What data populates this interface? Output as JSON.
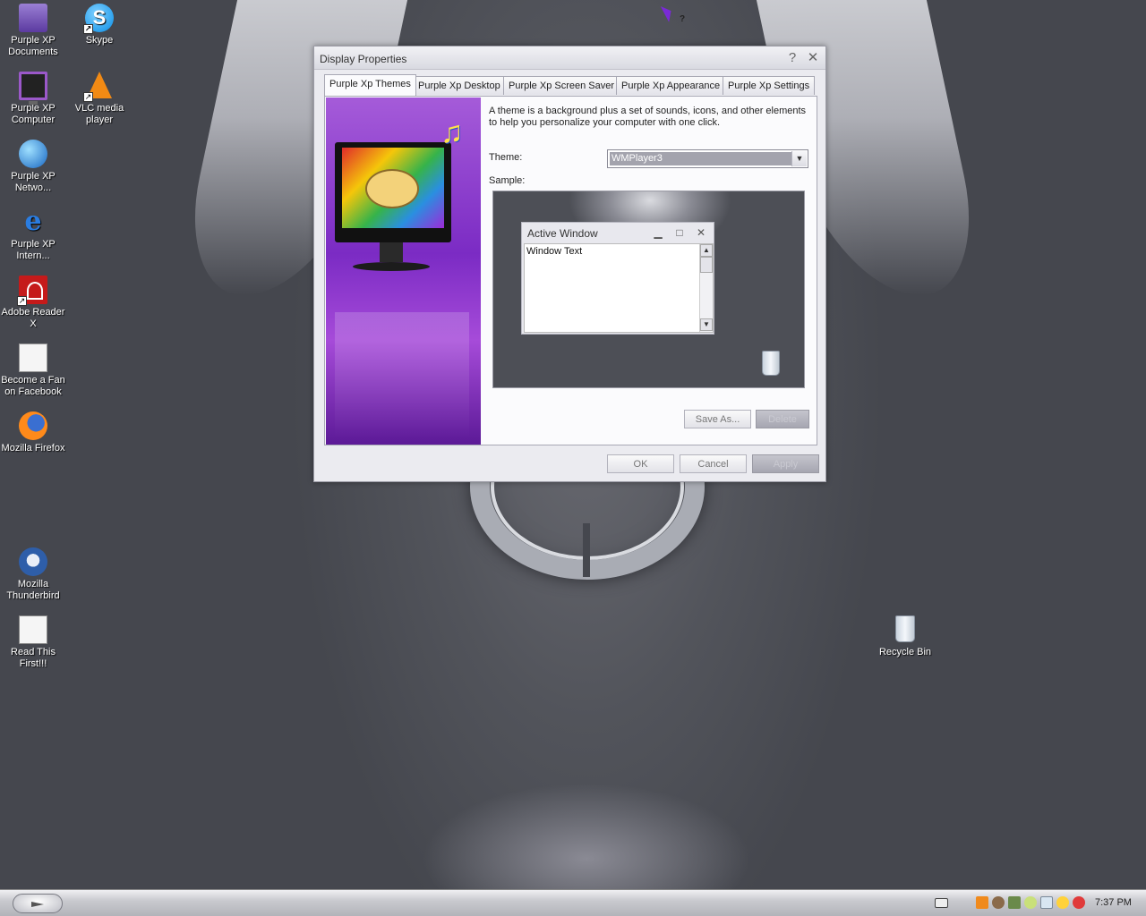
{
  "desktop": {
    "icons": [
      {
        "label": "Purple XP Documents",
        "icon": "documents-icon"
      },
      {
        "label": "Skype",
        "icon": "skype-icon"
      },
      {
        "label": "Purple XP Computer",
        "icon": "computer-icon"
      },
      {
        "label": "VLC media player",
        "icon": "vlc-icon"
      },
      {
        "label": "Purple XP Netwo...",
        "icon": "network-icon"
      },
      {
        "label": "Purple XP Intern...",
        "icon": "internet-explorer-icon"
      },
      {
        "label": "Adobe Reader X",
        "icon": "adobe-reader-icon"
      },
      {
        "label": "Become a Fan on Facebook",
        "icon": "document-icon"
      },
      {
        "label": "Mozilla Firefox",
        "icon": "firefox-icon"
      },
      {
        "label": "Mozilla Thunderbird",
        "icon": "thunderbird-icon"
      },
      {
        "label": "Read This First!!!",
        "icon": "readme-icon"
      },
      {
        "label": "Recycle Bin",
        "icon": "recycle-bin-icon"
      }
    ]
  },
  "dialog": {
    "title": "Display Properties",
    "help_glyph": "?",
    "close_glyph": "✕",
    "tabs": [
      {
        "label": "Purple Xp Themes",
        "active": true
      },
      {
        "label": "Purple Xp Desktop",
        "active": false
      },
      {
        "label": "Purple Xp Screen Saver",
        "active": false
      },
      {
        "label": "Purple Xp Appearance",
        "active": false
      },
      {
        "label": "Purple Xp Settings",
        "active": false
      }
    ],
    "description": "A theme is a background plus a set of sounds, icons, and other elements to help you personalize your computer with one click.",
    "theme_label": "Theme:",
    "theme_value": "WMPlayer3",
    "sample_label": "Sample:",
    "sample_window": {
      "title": "Active Window",
      "text": "Window Text",
      "minimize_glyph": "▁",
      "maximize_glyph": "□",
      "close_glyph": "✕"
    },
    "save_as_label": "Save As...",
    "delete_label": "Delete",
    "ok_label": "OK",
    "cancel_label": "Cancel",
    "apply_label": "Apply"
  },
  "taskbar": {
    "clock": "7:37 PM",
    "tray_icons": [
      "keyboard-icon",
      "app-icon",
      "people-icon",
      "tool-icon",
      "network-icon",
      "chat-icon",
      "display-icon",
      "smiley-icon",
      "security-icon"
    ]
  },
  "colors": {
    "dialog_bg": "#ebebf0",
    "art_purple": "#7b2bc4",
    "desktop_bg": "#45474e"
  }
}
